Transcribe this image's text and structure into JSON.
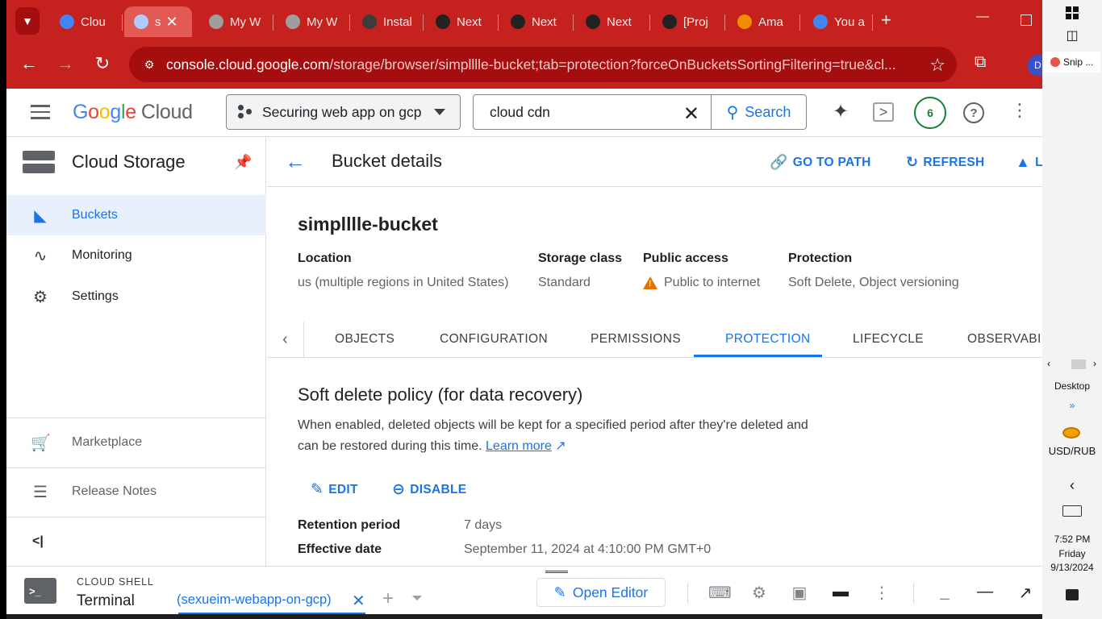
{
  "browser": {
    "tabs": [
      {
        "label": "Clou",
        "favicon_color": "#4285f4"
      },
      {
        "label": "s",
        "favicon_color": "#aecbfa"
      },
      {
        "label": "My W",
        "favicon_color": "#9e9e9e"
      },
      {
        "label": "My W",
        "favicon_color": "#9e9e9e"
      },
      {
        "label": "Instal",
        "favicon_color": "#3c3c3c"
      },
      {
        "label": "Next",
        "favicon_color": "#222222"
      },
      {
        "label": "Next",
        "favicon_color": "#222222"
      },
      {
        "label": "Next",
        "favicon_color": "#222222"
      },
      {
        "label": "[Proj",
        "favicon_color": "#222222"
      },
      {
        "label": "Ama",
        "favicon_color": "#f28c00"
      },
      {
        "label": "You a",
        "favicon_color": "#4285f4"
      }
    ],
    "new_tab_icon": "+",
    "url_main": "console.cloud.google.com",
    "url_rest": "/storage/browser/simplllle-bucket;tab=protection?forceOnBucketsSortingFiltering=true&cl...",
    "profile_initial": "D",
    "accent_color": "#c5221f"
  },
  "header": {
    "logo": [
      "G",
      "o",
      "o",
      "g",
      "l",
      "e"
    ],
    "logo_suffix": "Cloud",
    "project_name": "Securing web app on gcp",
    "search_value": "cloud cdn",
    "search_button": "Search",
    "notifications_count": "6",
    "help_glyph": "?"
  },
  "sidebar": {
    "title": "Cloud Storage",
    "items": [
      {
        "label": "Buckets",
        "icon": "bucket-icon"
      },
      {
        "label": "Monitoring",
        "icon": "monitoring-icon"
      },
      {
        "label": "Settings",
        "icon": "gear-icon"
      }
    ],
    "footer_items": [
      {
        "label": "Marketplace",
        "icon": "cart-icon"
      },
      {
        "label": "Release Notes",
        "icon": "notes-icon"
      }
    ],
    "collapse_label": "<|"
  },
  "main": {
    "title": "Bucket details",
    "actions": [
      "GO TO PATH",
      "REFRESH",
      "LE"
    ],
    "bucket_name": "simplllle-bucket",
    "properties": [
      {
        "key": "Location",
        "value": "us (multiple regions in United States)"
      },
      {
        "key": "Storage class",
        "value": "Standard"
      },
      {
        "key": "Public access",
        "value": "Public to internet"
      },
      {
        "key": "Protection",
        "value": "Soft Delete, Object versioning"
      }
    ],
    "tabs": [
      "OBJECTS",
      "CONFIGURATION",
      "PERMISSIONS",
      "PROTECTION",
      "LIFECYCLE",
      "OBSERVABILI"
    ],
    "active_tab": "PROTECTION",
    "soft_delete": {
      "title": "Soft delete policy (for data recovery)",
      "description": "When enabled, deleted objects will be kept for a specified period after they're deleted and can be restored during this time.",
      "learn_more": "Learn more",
      "edit_label": "EDIT",
      "disable_label": "DISABLE",
      "retention_label": "Retention period",
      "retention_value": "7 days",
      "effective_label": "Effective date",
      "effective_value": "September 11, 2024 at 4:10:00 PM GMT+0"
    }
  },
  "shell": {
    "heading": "CLOUD SHELL",
    "terminal_label": "Terminal",
    "session": "(sexueim-webapp-on-gcp)",
    "open_editor": "Open Editor"
  },
  "taskbar": {
    "snip_label": "Snip ...",
    "desktop_label": "Desktop",
    "more_glyph": "»",
    "currency_label": "USD/RUB",
    "time": "7:52 PM",
    "day": "Friday",
    "date": "9/13/2024"
  }
}
